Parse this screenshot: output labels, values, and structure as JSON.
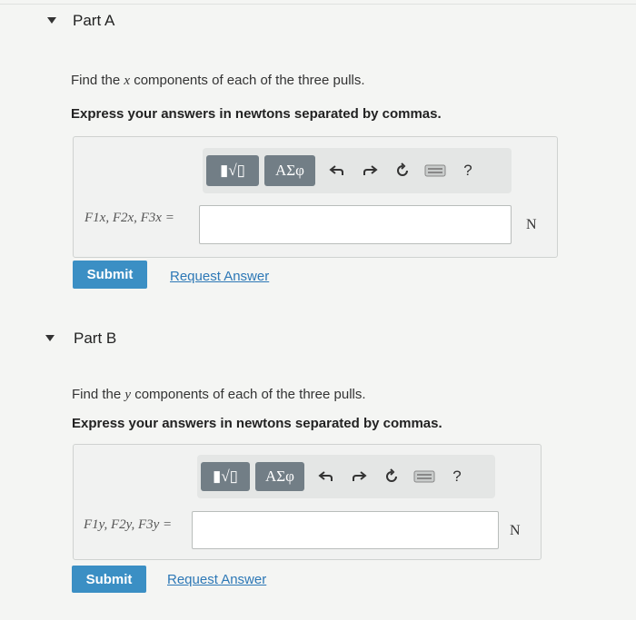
{
  "parts": [
    {
      "title": "Part A",
      "instruction": "Find the x components of each of the three pulls.",
      "instruction_pre": "Find the ",
      "instruction_var": "x",
      "instruction_post": " components of each of the three pulls.",
      "express": "Express your answers in newtons separated by commas.",
      "toolbar": {
        "sqrt_label": "▮√▯",
        "greek_label": "ΑΣφ",
        "help_label": "?"
      },
      "label": "F1x, F2x, F3x =",
      "input_value": "",
      "unit": "N",
      "submit_label": "Submit",
      "request_label": "Request Answer"
    },
    {
      "title": "Part B",
      "instruction": "Find the y components of each of the three pulls.",
      "instruction_pre": "Find the ",
      "instruction_var": "y",
      "instruction_post": " components of each of the three pulls.",
      "express": "Express your answers in newtons separated by commas.",
      "toolbar": {
        "sqrt_label": "▮√▯",
        "greek_label": "ΑΣφ",
        "help_label": "?"
      },
      "label": "F1y, F2y, F3y =",
      "input_value": "",
      "unit": "N",
      "submit_label": "Submit",
      "request_label": "Request Answer"
    }
  ],
  "colors": {
    "submit": "#3b8fc4",
    "link": "#2d78b6",
    "toolbar_button": "#727e86"
  }
}
